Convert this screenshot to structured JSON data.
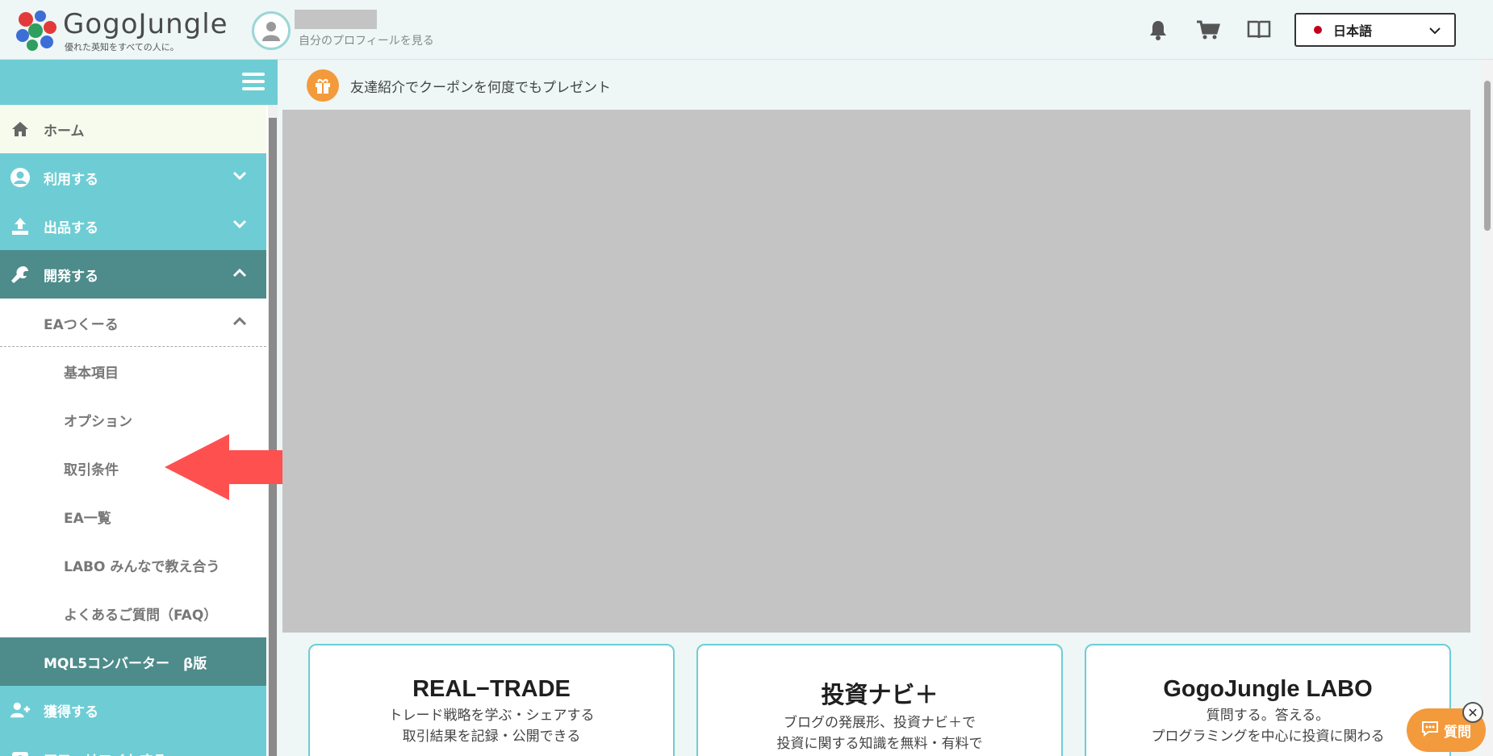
{
  "header": {
    "logo_name": "GogoJungle",
    "logo_tagline": "優れた英知をすべての人に。",
    "profile_link": "自分のプロフィールを見る",
    "language": "日本語"
  },
  "sidebar": {
    "items": [
      {
        "label": "ホーム"
      },
      {
        "label": "利用する"
      },
      {
        "label": "出品する"
      },
      {
        "label": "開発する"
      },
      {
        "label": "EAつくーる"
      },
      {
        "label": "基本項目"
      },
      {
        "label": "オプション"
      },
      {
        "label": "取引条件"
      },
      {
        "label": "EA一覧"
      },
      {
        "label": "LABO みんなで教え合う"
      },
      {
        "label": "よくあるご質問（FAQ）"
      },
      {
        "label": "MQL5コンバーター　β版"
      },
      {
        "label": "獲得する"
      },
      {
        "label": "アフィリエイトする"
      }
    ]
  },
  "banner": {
    "text": "友達紹介でクーポンを何度でもプレゼント"
  },
  "cards": [
    {
      "title": "REAL−TRADE",
      "line1": "トレード戦略を学ぶ・シェアする",
      "line2": "取引結果を記録・公開できる"
    },
    {
      "title": "投資ナビ＋",
      "line1": "ブログの発展形、投資ナビ＋で",
      "line2": "投資に関する知識を無料・有料で"
    },
    {
      "title": "GogoJungle LABO",
      "line1": "質問する。答える。",
      "line2": "プログラミングを中心に投資に関わる"
    }
  ],
  "chat": {
    "label": "質問",
    "close": "✕"
  },
  "colors": {
    "teal": "#6ecdd4",
    "dark_teal": "#4e8b8b",
    "orange": "#f39a3c",
    "arrow_red": "#ff5050"
  }
}
